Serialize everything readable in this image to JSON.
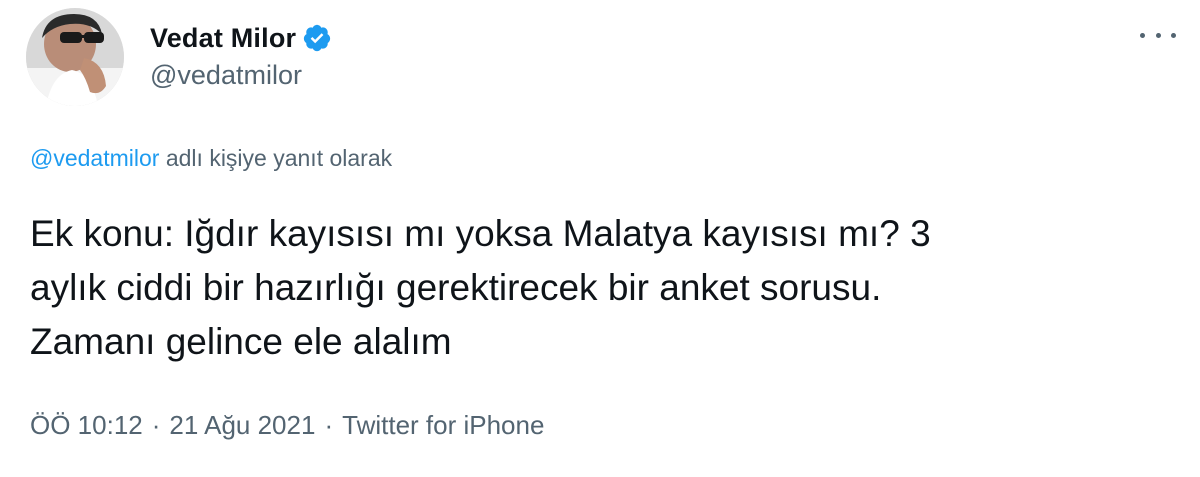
{
  "author": {
    "display_name": "Vedat Milor",
    "handle": "@vedatmilor",
    "verified": true
  },
  "reply": {
    "mention": "@vedatmilor",
    "suffix": " adlı kişiye yanıt olarak"
  },
  "tweet": {
    "lines": [
      "Ek konu: Iğdır kayısısı mı yoksa Malatya kayısısı mı? 3",
      "aylık ciddi bir hazırlığı gerektirecek bir anket sorusu.",
      "Zamanı gelince ele alalım"
    ]
  },
  "meta": {
    "time": "ÖÖ 10:12",
    "separator": "·",
    "date": "21 Ağu 2021",
    "source": "Twitter for iPhone"
  },
  "colors": {
    "accent": "#1d9bf0",
    "text": "#0f1419",
    "secondary": "#536471"
  },
  "icons": {
    "verified": "verified-badge-icon",
    "more": "more-options-icon"
  }
}
